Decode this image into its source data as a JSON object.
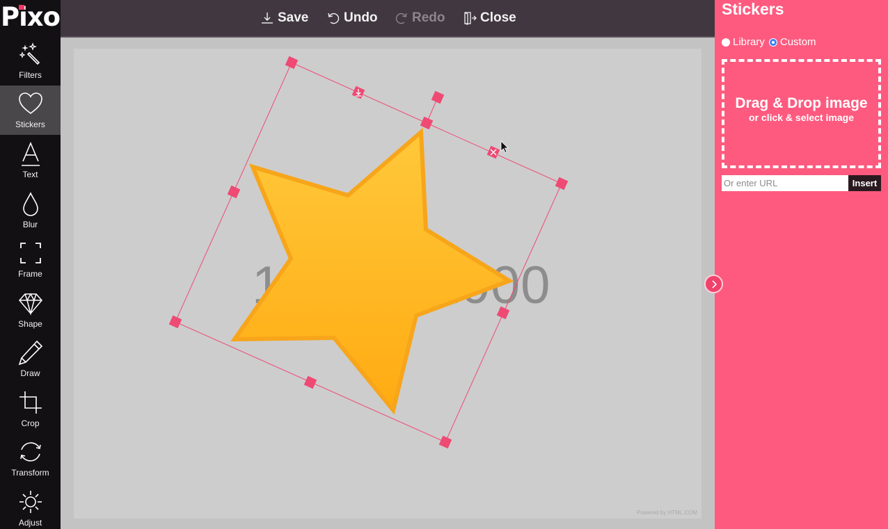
{
  "app": {
    "logo": "Pixo",
    "accent_color": "#fe5a7f",
    "handle_color": "#ee4a74"
  },
  "sidebar": {
    "active": "Stickers",
    "items": [
      {
        "id": "filters",
        "label": "Filters",
        "icon": "magic-wand-icon"
      },
      {
        "id": "stickers",
        "label": "Stickers",
        "icon": "heart-icon"
      },
      {
        "id": "text",
        "label": "Text",
        "icon": "text-icon"
      },
      {
        "id": "blur",
        "label": "Blur",
        "icon": "droplet-icon"
      },
      {
        "id": "frame",
        "label": "Frame",
        "icon": "frame-icon"
      },
      {
        "id": "shape",
        "label": "Shape",
        "icon": "diamond-icon"
      },
      {
        "id": "draw",
        "label": "Draw",
        "icon": "pencil-icon"
      },
      {
        "id": "crop",
        "label": "Crop",
        "icon": "crop-icon"
      },
      {
        "id": "transform",
        "label": "Transform",
        "icon": "rotate-icon"
      },
      {
        "id": "adjust",
        "label": "Adjust",
        "icon": "sun-icon"
      }
    ]
  },
  "toolbar": {
    "save_label": "Save",
    "undo_label": "Undo",
    "redo_label": "Redo",
    "redo_disabled": true,
    "close_label": "Close"
  },
  "canvas": {
    "background_text": "1000 x 1000",
    "watermark": "Powered by HTML.COM",
    "sticker": {
      "type": "star",
      "fill_color": "#ffb61f",
      "rotation_deg": 24
    }
  },
  "panel": {
    "title": "Stickers",
    "source_options": [
      {
        "label": "Library",
        "checked": false
      },
      {
        "label": "Custom",
        "checked": true
      }
    ],
    "dropzone_main": "Drag & Drop image",
    "dropzone_sub": "or click & select image",
    "url_placeholder": "Or enter URL",
    "url_value": "",
    "insert_label": "Insert"
  }
}
